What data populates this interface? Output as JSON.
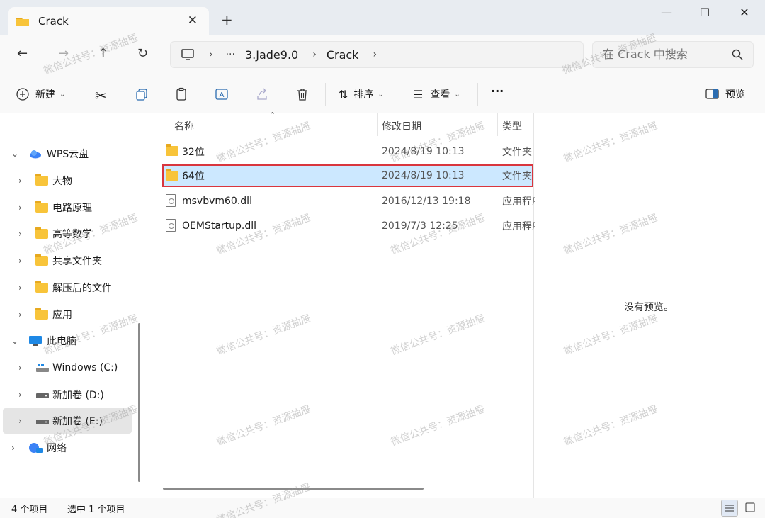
{
  "tab": {
    "title": "Crack"
  },
  "address": {
    "crumbs": [
      "3.Jade9.0",
      "Crack"
    ],
    "search_placeholder": "在 Crack 中搜索"
  },
  "toolbar": {
    "new_label": "新建",
    "sort_label": "排序",
    "view_label": "查看",
    "more_label": "···",
    "preview_label": "预览"
  },
  "nav": {
    "items": [
      {
        "label": "WPS云盘"
      },
      {
        "label": "大物"
      },
      {
        "label": "电路原理"
      },
      {
        "label": "高等数学"
      },
      {
        "label": "共享文件夹"
      },
      {
        "label": "解压后的文件"
      },
      {
        "label": "应用"
      },
      {
        "label": "此电脑"
      },
      {
        "label": "Windows (C:)"
      },
      {
        "label": "新加卷 (D:)"
      },
      {
        "label": "新加卷 (E:)"
      },
      {
        "label": "网络"
      }
    ]
  },
  "files": {
    "headers": {
      "name": "名称",
      "date": "修改日期",
      "type": "类型"
    },
    "rows": [
      {
        "name": "32位",
        "date": "2024/8/19 10:13",
        "type": "文件夹"
      },
      {
        "name": "64位",
        "date": "2024/8/19 10:13",
        "type": "文件夹"
      },
      {
        "name": "msvbvm60.dll",
        "date": "2016/12/13 19:18",
        "type": "应用程序扩展"
      },
      {
        "name": "OEMStartup.dll",
        "date": "2019/7/3 12:25",
        "type": "应用程序扩展"
      }
    ]
  },
  "preview": {
    "empty_text": "没有预览。"
  },
  "status": {
    "count": "4 个项目",
    "selected": "选中 1 个项目"
  },
  "watermark": "微信公共号：资源抽屉",
  "colors": {
    "selection": "#cce8ff",
    "highlight_border": "#d9363e",
    "folder": "#f8c43a"
  }
}
